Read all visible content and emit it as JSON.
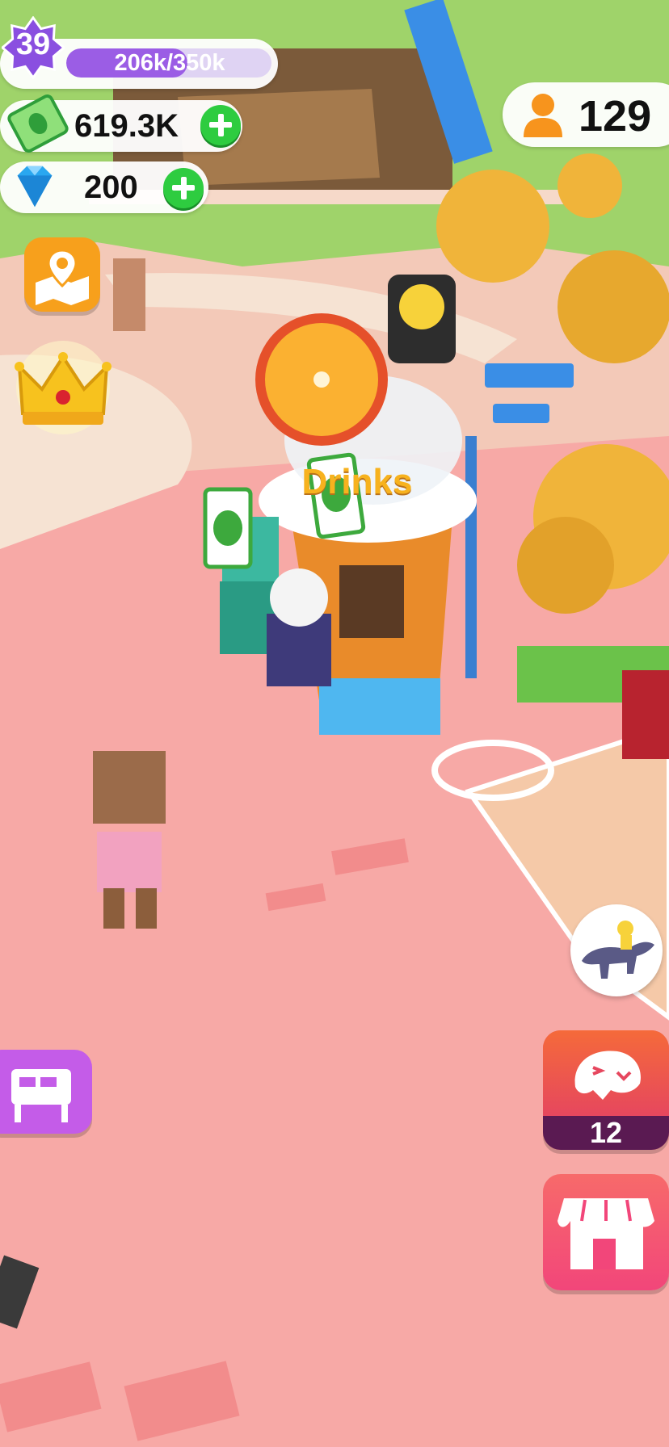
{
  "hud": {
    "level": "39",
    "xp_progress": "206k/350k",
    "xp_fraction": 0.59,
    "money": "619.3K",
    "gems": "200",
    "visitors": "129"
  },
  "scene": {
    "stand_sign": "Drinks"
  },
  "buttons": {
    "dino_count": "12"
  },
  "colors": {
    "accent_purple": "#8a4fe0",
    "xp_bar": "#9b5de5",
    "plus_green": "#2ecc40",
    "map_button": "#f7a01c",
    "dino_button": "#e6475e",
    "shop_button": "#f35b78",
    "stand_button": "#c45ce8",
    "ground": "#f7a9a6"
  },
  "icons": {
    "level": "star-badge-icon",
    "money": "cash-icon",
    "gems": "diamond-icon",
    "visitors": "person-icon",
    "map": "map-pin-icon",
    "crown": "crown-icon",
    "dino_rider": "dinosaur-rider-icon",
    "dino_egg": "dino-head-icon",
    "shop": "shop-awning-icon",
    "stand": "stand-icon"
  }
}
